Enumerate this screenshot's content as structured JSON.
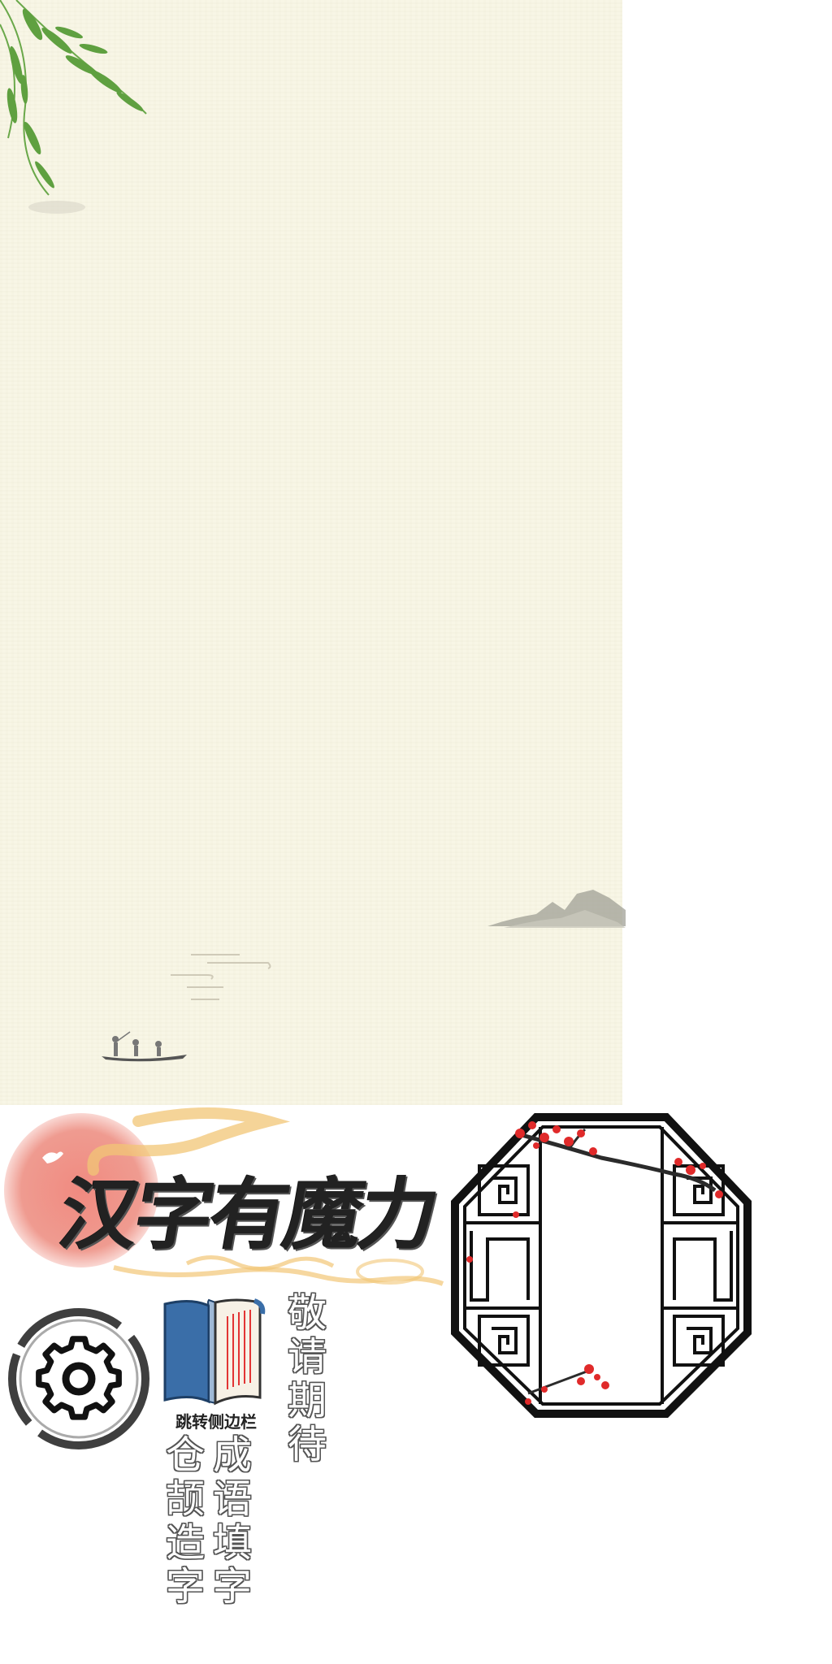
{
  "game": {
    "title": "汉字有魔力",
    "book_label": "跳转侧边栏",
    "coming_soon": "敬请期待",
    "modes": {
      "idiom_fill": "成语填字",
      "cangjie": "仓颉造字"
    }
  },
  "colors": {
    "parchment": "#f8f6e6",
    "ink": "#222222",
    "sun": "#f08a80",
    "plum_blossom": "#e02a2a",
    "book_blue": "#3a6ea8",
    "cloud_gold": "#f2c676"
  },
  "icons": {
    "settings": "gear-icon",
    "book": "book-icon",
    "window": "octagon-window-frame",
    "willow": "willow-branch",
    "boat": "fishing-boat"
  }
}
